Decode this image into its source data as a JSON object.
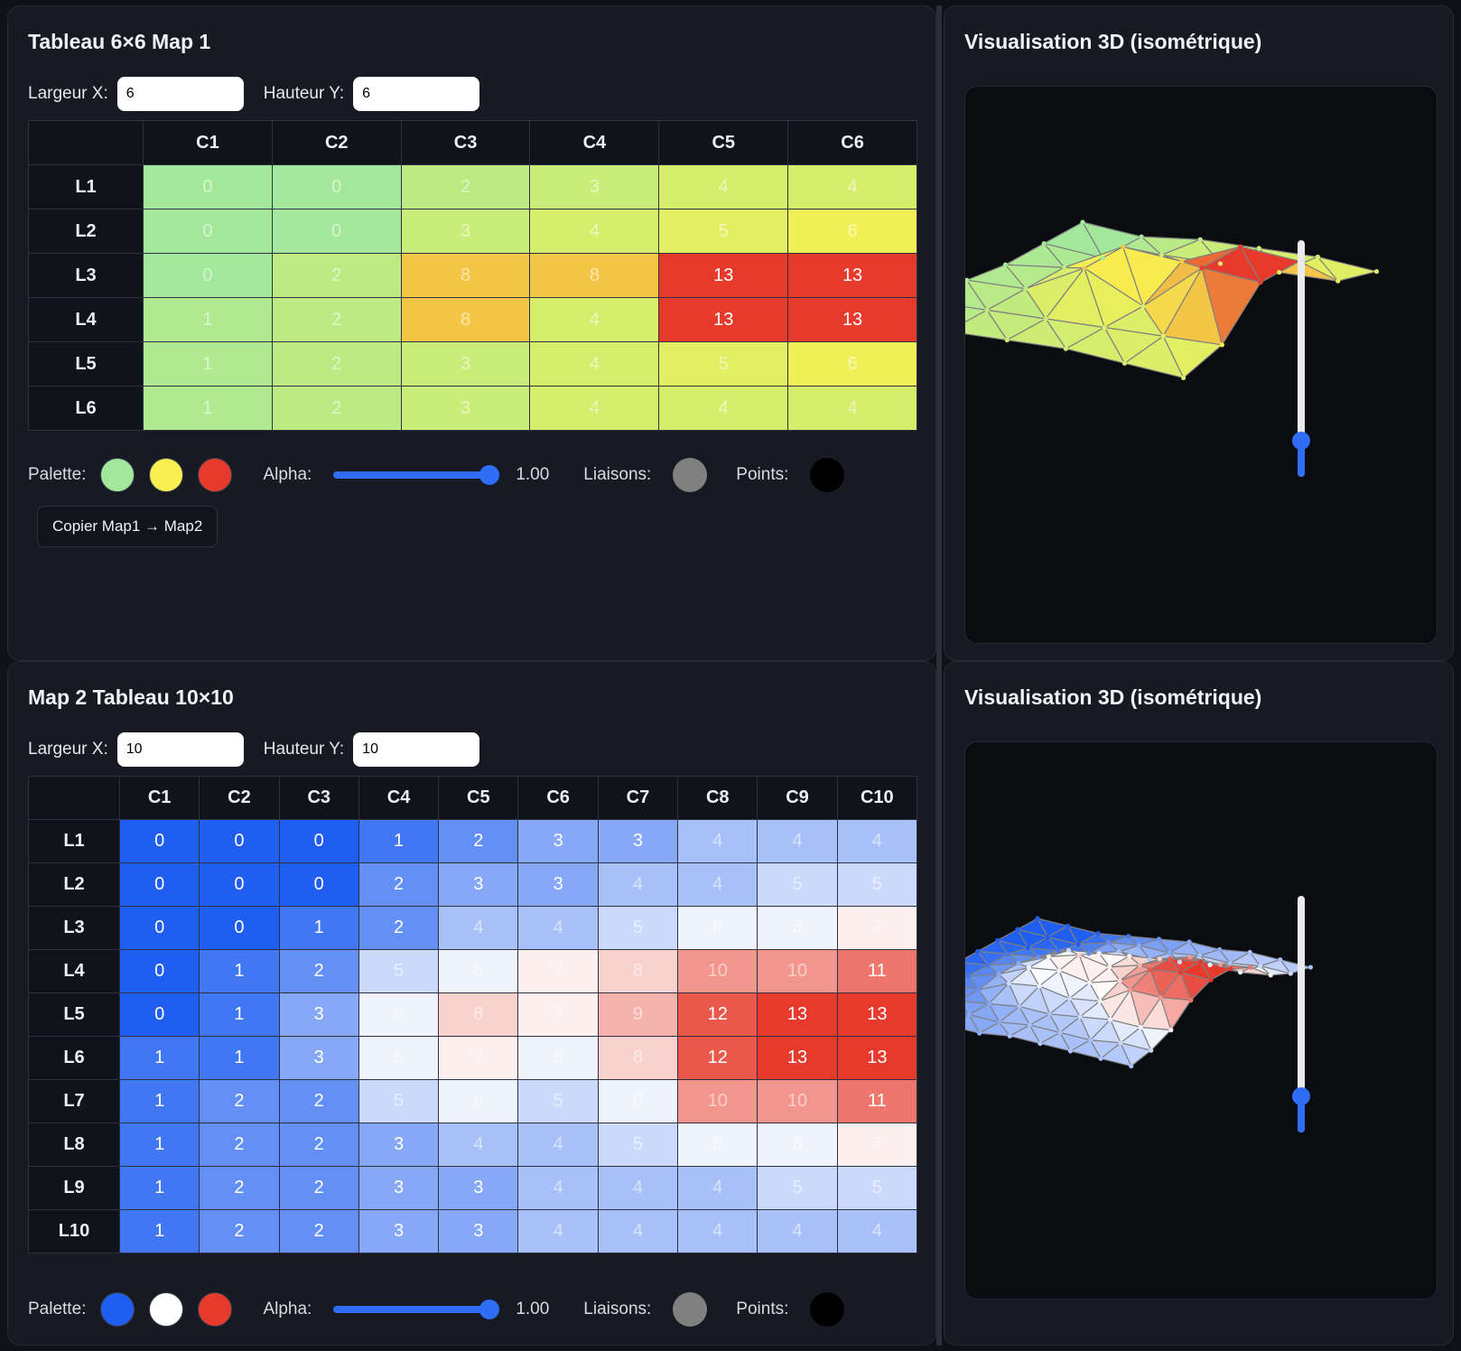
{
  "map1": {
    "title": "Tableau 6×6 Map 1",
    "width_label": "Largeur X:",
    "width_value": "6",
    "height_label": "Hauteur Y:",
    "height_value": "6",
    "columns": [
      "C1",
      "C2",
      "C3",
      "C4",
      "C5",
      "C6"
    ],
    "rows": [
      "L1",
      "L2",
      "L3",
      "L4",
      "L5",
      "L6"
    ],
    "values": [
      [
        0,
        0,
        2,
        3,
        4,
        4
      ],
      [
        0,
        0,
        3,
        4,
        5,
        6
      ],
      [
        0,
        2,
        8,
        8,
        13,
        13
      ],
      [
        1,
        2,
        8,
        4,
        13,
        13
      ],
      [
        1,
        2,
        3,
        4,
        5,
        6
      ],
      [
        1,
        2,
        3,
        4,
        4,
        4
      ]
    ],
    "palette_label": "Palette:",
    "palette": [
      "#a3e89a",
      "#f7f050",
      "#e63a2c"
    ],
    "alpha_label": "Alpha:",
    "alpha_value": "1.00",
    "liaisons_label": "Liaisons:",
    "liaisons_color": "#808080",
    "points_label": "Points:",
    "points_color": "#000000",
    "copy_button": "Copier Map1 → Map2"
  },
  "view1": {
    "title": "Visualisation 3D (isométrique)"
  },
  "map2": {
    "title": "Map 2 Tableau 10×10",
    "width_label": "Largeur X:",
    "width_value": "10",
    "height_label": "Hauteur Y:",
    "height_value": "10",
    "columns": [
      "C1",
      "C2",
      "C3",
      "C4",
      "C5",
      "C6",
      "C7",
      "C8",
      "C9",
      "C10"
    ],
    "rows": [
      "L1",
      "L2",
      "L3",
      "L4",
      "L5",
      "L6",
      "L7",
      "L8",
      "L9",
      "L10"
    ],
    "values": [
      [
        0,
        0,
        0,
        1,
        2,
        3,
        3,
        4,
        4,
        4
      ],
      [
        0,
        0,
        0,
        2,
        3,
        3,
        4,
        4,
        5,
        5
      ],
      [
        0,
        0,
        1,
        2,
        4,
        4,
        5,
        6,
        6,
        7
      ],
      [
        0,
        1,
        2,
        5,
        6,
        7,
        8,
        10,
        10,
        11
      ],
      [
        0,
        1,
        3,
        6,
        8,
        7,
        9,
        12,
        13,
        13
      ],
      [
        1,
        1,
        3,
        6,
        7,
        6,
        8,
        12,
        13,
        13
      ],
      [
        1,
        2,
        2,
        5,
        6,
        5,
        6,
        10,
        10,
        11
      ],
      [
        1,
        2,
        2,
        3,
        4,
        4,
        5,
        6,
        6,
        7
      ],
      [
        1,
        2,
        2,
        3,
        3,
        4,
        4,
        4,
        5,
        5
      ],
      [
        1,
        2,
        2,
        3,
        3,
        4,
        4,
        4,
        4,
        4
      ]
    ],
    "palette_label": "Palette:",
    "palette": [
      "#1f5ef0",
      "#ffffff",
      "#e63a2c"
    ],
    "alpha_label": "Alpha:",
    "alpha_value": "1.00",
    "liaisons_label": "Liaisons:",
    "liaisons_color": "#808080",
    "points_label": "Points:",
    "points_color": "#000000"
  },
  "view2": {
    "title": "Visualisation 3D (isométrique)"
  }
}
